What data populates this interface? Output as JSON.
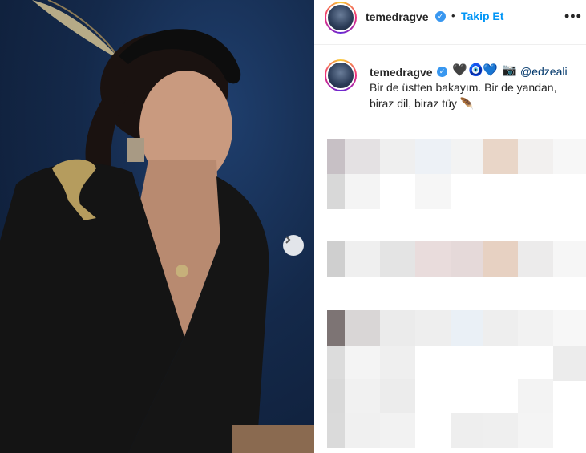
{
  "post": {
    "username": "temedragve",
    "follow_label": "Takip Et",
    "dot": "•",
    "more_glyph": "•••"
  },
  "caption": {
    "username": "temedragve",
    "emojis": [
      "🖤",
      "🧿",
      "💙",
      "📷"
    ],
    "mention": "@edzeali",
    "text": "Bir de üstten bakayım. Bir de yandan, biraz dil, biraz tüy 🪶"
  },
  "colors": {
    "follow": "#0095f6",
    "verified": "#3897f0",
    "mention": "#00376b",
    "photo_background": "#14294a"
  },
  "icons": {
    "verified": "verified-badge-icon",
    "next": "chevron-right-icon",
    "more": "more-options-icon"
  }
}
